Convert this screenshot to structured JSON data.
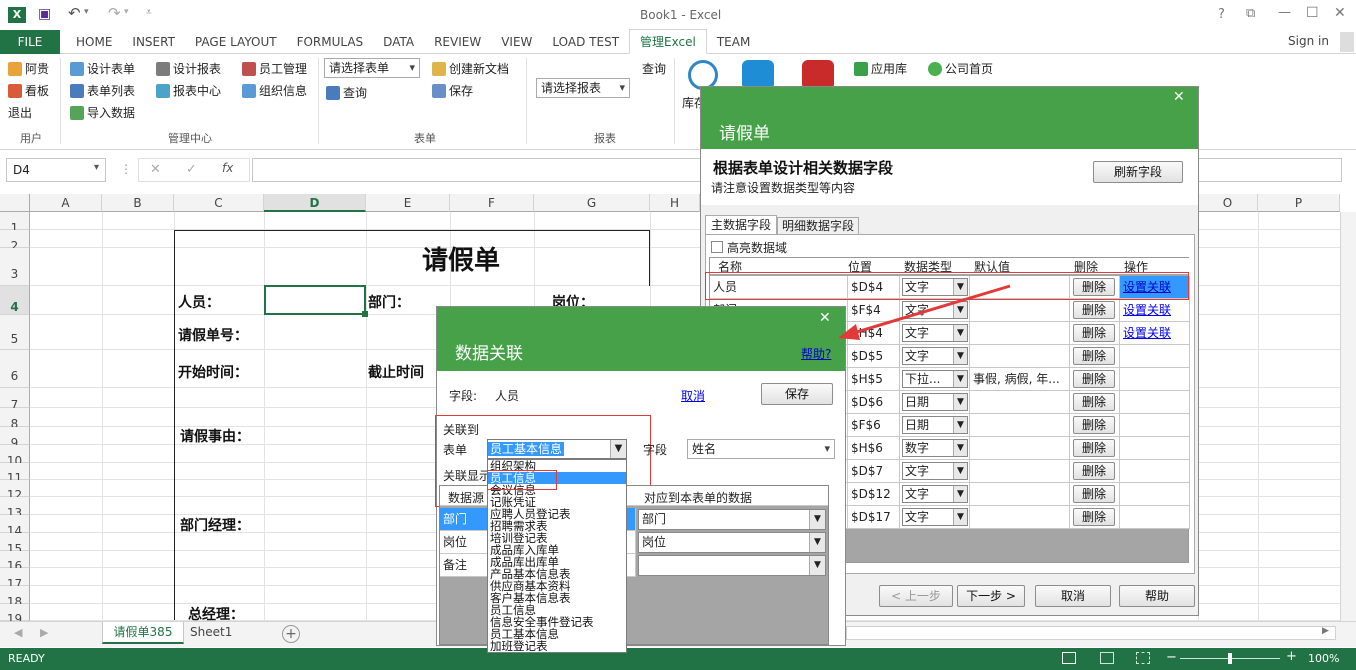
{
  "app": {
    "title": "Book1 - Excel",
    "logo_letter": "X",
    "window_controls": [
      "?",
      "⧉",
      "—",
      "☐",
      "✕"
    ]
  },
  "ribbon_tabs": [
    "FILE",
    "HOME",
    "INSERT",
    "PAGE LAYOUT",
    "FORMULAS",
    "DATA",
    "REVIEW",
    "VIEW",
    "LOAD TEST",
    "管理Excel",
    "TEAM"
  ],
  "active_tab": "管理Excel",
  "sign_in": "Sign in",
  "ribbon": {
    "user_group": {
      "items": [
        "阿贵",
        "看板",
        "退出"
      ],
      "label": "用户"
    },
    "mgmt_group": {
      "col1": [
        "设计表单",
        "表单列表",
        "导入数据"
      ],
      "col2": [
        "设计报表",
        "报表中心"
      ],
      "col3": [
        "员工管理",
        "组织信息"
      ],
      "label": "管理中心"
    },
    "form_group": {
      "combo": "请选择表单",
      "items": [
        "查询",
        "创建新文档",
        "保存"
      ],
      "label": "表单"
    },
    "report_group": {
      "combo": "请选择报表",
      "query": "查询",
      "label": "报表"
    },
    "big_icons": [
      "库存"
    ],
    "right_items": [
      "应用库",
      "公司首页"
    ]
  },
  "formula_bar": {
    "name_box": "D4",
    "fx": "fx",
    "cancel": "✕",
    "enter": "✓"
  },
  "columns": [
    "A",
    "B",
    "C",
    "D",
    "E",
    "F",
    "G",
    "H",
    "O",
    "P"
  ],
  "rows": [
    "1",
    "2",
    "3",
    "4",
    "5",
    "6",
    "7",
    "8",
    "9",
    "10",
    "11",
    "12",
    "13",
    "14",
    "15",
    "16",
    "17",
    "18",
    "19"
  ],
  "sheet": {
    "title": "请假单",
    "labels": {
      "person": "人员：",
      "dept": "部门：",
      "post": "岗位：",
      "leave_no": "请假单号：",
      "start": "开始时间：",
      "end": "截止时间",
      "reason": "请假事由：",
      "dept_mgr": "部门经理：",
      "gm": "总经理："
    }
  },
  "sheet_tabs": [
    "请假单385",
    "Sheet1"
  ],
  "status": {
    "ready": "READY",
    "zoom": "100%"
  },
  "field_dialog": {
    "title": "请假单",
    "heading": "根据表单设计相关数据字段",
    "subheading": "请注意设置数据类型等内容",
    "refresh": "刷新字段",
    "tabs": [
      "主数据字段",
      "明细数据字段"
    ],
    "highlight_label": "高亮数据域",
    "columns": [
      "名称",
      "位置",
      "数据类型",
      "默认值",
      "删除",
      "操作"
    ],
    "rows": [
      {
        "name": "人员",
        "pos": "$D$4",
        "type": "文字",
        "default": "",
        "del": "删除",
        "op": "设置关联"
      },
      {
        "name": "部门",
        "pos": "$F$4",
        "type": "文字",
        "default": "",
        "del": "删除",
        "op": "设置关联"
      },
      {
        "name": "",
        "pos": "$H$4",
        "type": "文字",
        "default": "",
        "del": "删除",
        "op": "设置关联"
      },
      {
        "name": "",
        "pos": "$D$5",
        "type": "文字",
        "default": "",
        "del": "删除",
        "op": ""
      },
      {
        "name": "",
        "pos": "$H$5",
        "type": "下拉...",
        "default": "事假, 病假, 年...",
        "del": "删除",
        "op": ""
      },
      {
        "name": "",
        "pos": "$D$6",
        "type": "日期",
        "default": "",
        "del": "删除",
        "op": ""
      },
      {
        "name": "",
        "pos": "$F$6",
        "type": "日期",
        "default": "",
        "del": "删除",
        "op": ""
      },
      {
        "name": "",
        "pos": "$H$6",
        "type": "数字",
        "default": "",
        "del": "删除",
        "op": ""
      },
      {
        "name": "",
        "pos": "$D$7",
        "type": "文字",
        "default": "",
        "del": "删除",
        "op": ""
      },
      {
        "name": "",
        "pos": "$D$12",
        "type": "文字",
        "default": "",
        "del": "删除",
        "op": ""
      },
      {
        "name": "",
        "pos": "$D$17",
        "type": "文字",
        "default": "",
        "del": "删除",
        "op": ""
      }
    ],
    "prev": "< 上一步",
    "next": "下一步 >",
    "cancel": "取消",
    "help": "帮助"
  },
  "link_dialog": {
    "title": "数据关联",
    "help": "帮助?",
    "field_label": "字段:",
    "field_value": "人员",
    "cancel": "取消",
    "save": "保存",
    "link_to": "关联到",
    "form_label": "表单",
    "form_value": "员工基本信息",
    "field2_label": "字段",
    "field2_value": "姓名",
    "display_label": "关联显示",
    "grid_headers": [
      "数据源",
      "对应到本表单的数据"
    ],
    "grid_rows": [
      {
        "src": "部门",
        "dst": "部门"
      },
      {
        "src": "岗位",
        "dst": "岗位"
      },
      {
        "src": "备注",
        "dst": ""
      }
    ],
    "dropdown": [
      "组织架构",
      "员工信息",
      "会议信息",
      "记账凭证",
      "应聘人员登记表",
      "招聘需求表",
      "培训登记表",
      "成品库入库单",
      "成品库出库单",
      "产品基本信息表",
      "供应商基本资料",
      "客户基本信息表",
      "员工信息",
      "信息安全事件登记表",
      "员工基本信息",
      "加班登记表"
    ],
    "dropdown_selected": 1
  }
}
